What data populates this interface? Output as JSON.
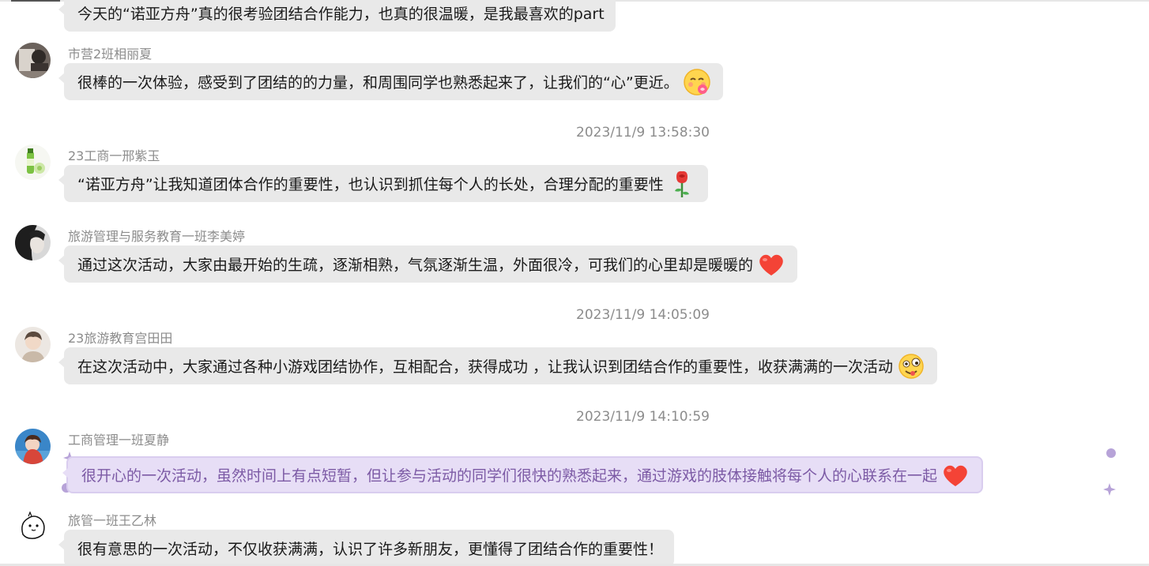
{
  "messages": [
    {
      "sender": "",
      "text": "今天的“诺亚方舟”真的很考验团结合作能力，也真的很温暖，是我最喜欢的part",
      "emoji": ""
    },
    {
      "sender": "市营2班相丽夏",
      "text": "很棒的一次体验，感受到了团结的的力量，和周围同学也熟悉起来了，让我们的“心”更近。",
      "emoji": "smiling-face-icon"
    },
    {
      "sender": "23工商一邢紫玉",
      "text": "“诺亚方舟”让我知道团体合作的重要性，也认识到抓住每个人的长处，合理分配的重要性",
      "emoji": "rose-icon"
    },
    {
      "sender": "旅游管理与服务教育一班李美婷",
      "text": "通过这次活动，大家由最开始的生疏，逐渐相熟，气氛逐渐生温，外面很冷，可我们的心里却是暖暖的",
      "emoji": "heart-icon"
    },
    {
      "sender": "23旅游教育宫田田",
      "text": "在这次活动中，大家通过各种小游戏团结协作，互相配合，获得成功 ，让我认识到团结合作的重要性，收获满满的一次活动",
      "emoji": "zany-face-icon"
    },
    {
      "sender": "工商管理一班夏静",
      "text": "很开心的一次活动，虽然时间上有点短暂，但让参与活动的同学们很快的熟悉起来，通过游戏的肢体接触将每个人的心联系在一起",
      "emoji": "heart-icon"
    },
    {
      "sender": "旅管一班王乙林",
      "text": "很有意思的一次活动，不仅收获满满，认识了许多新朋友，更懂得了团结合作的重要性！",
      "emoji": ""
    }
  ],
  "timestamps": [
    "2023/11/9 13:58:30",
    "2023/11/9 14:05:09",
    "2023/11/9 14:10:59"
  ],
  "colors": {
    "bubble": "#e9e9e9",
    "fancy_bubble": "#e7def6",
    "fancy_text": "#7c5aa5",
    "meta_text": "#8c8c8c"
  }
}
